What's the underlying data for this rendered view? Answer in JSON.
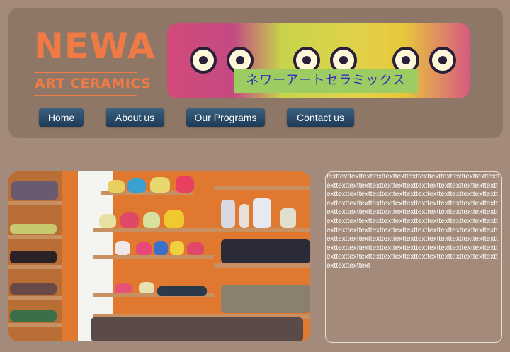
{
  "logo": {
    "main": "NEWA",
    "sub": "ART CERAMICS"
  },
  "banner": {
    "caption": "ネワーアートセラミックス"
  },
  "nav": {
    "items": [
      {
        "label": "Home"
      },
      {
        "label": "About us"
      },
      {
        "label": "Our Programs"
      },
      {
        "label": "Contact us"
      }
    ]
  },
  "content": {
    "body_text": "texttexttexttexttexttexttexttexttexttexttexttexttexttexttexttexttexttexttexttexttexttexttexttexttexttexttexttexttexttexttexttexttexttexttexttexttexttexttexttexttexttexttexttexttexttexttexttexttexttexttexttexttexttexttexttexttexttexttexttexttexttexttexttexttexttexttexttexttexttexttexttexttexttexttexttexttexttexttexttexttexttexttexttexttexttexttexttexttexttexttexttexttexttexttexttexttexttexttexttexttexttexttexttexttexttexttexttexttexttexttexttexttexttexttexttexttexttexttexttexttexttexttexttexttexttexttexttexttexttexttexttexttexttexttexttexttexttexttexttexttexttexttexttexttexttexttexttexttexttexttexttexttexttext"
  },
  "colors": {
    "page_bg": "#a38a7a",
    "header_bg": "#8f7767",
    "logo": "#f07a45",
    "nav_button": "#2a4a68"
  }
}
